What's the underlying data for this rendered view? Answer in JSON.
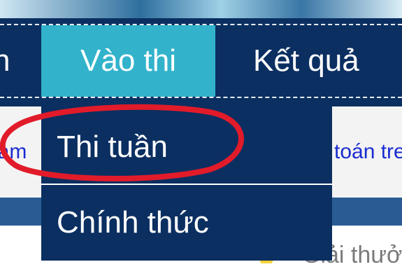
{
  "nav": {
    "partial_left_label": "n",
    "active_label": "Vào thi",
    "next_label": "Kết quả"
  },
  "dropdown": {
    "items": [
      {
        "label": "Thi tuần"
      },
      {
        "label": "Chính thức"
      }
    ]
  },
  "background": {
    "link_left": "ham",
    "link_right": "toán tre",
    "bottom_text": "Giải thưở"
  },
  "annotation": {
    "highlight_color": "#e21b2a"
  }
}
